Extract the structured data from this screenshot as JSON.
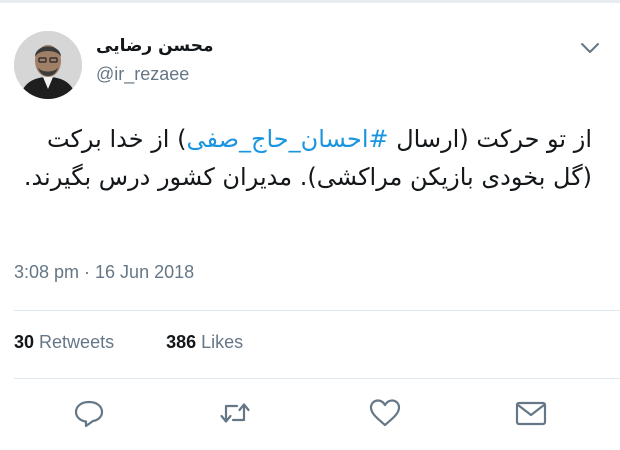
{
  "tweet": {
    "display_name": "محسن رضایی",
    "handle": "@ir_rezaee",
    "text_part1": "از تو حرکت (ارسال ",
    "hashtag": "#احسان_حاج_صفی",
    "text_part2": ") از خدا برکت (گل بخودی بازیکن مراکشی). مدیران کشور درس بگیرند.",
    "timestamp": "3:08 pm · 16 Jun 2018"
  },
  "stats": {
    "retweets_count": "30",
    "retweets_label": "Retweets",
    "likes_count": "386",
    "likes_label": "Likes"
  },
  "icons": {
    "menu": "chevron-down-icon",
    "reply": "reply-icon",
    "retweet": "retweet-icon",
    "like": "heart-icon",
    "message": "envelope-icon"
  },
  "colors": {
    "text": "#14171a",
    "secondary": "#657786",
    "hashtag": "#1b95e0",
    "divider": "#e1e8ed"
  }
}
